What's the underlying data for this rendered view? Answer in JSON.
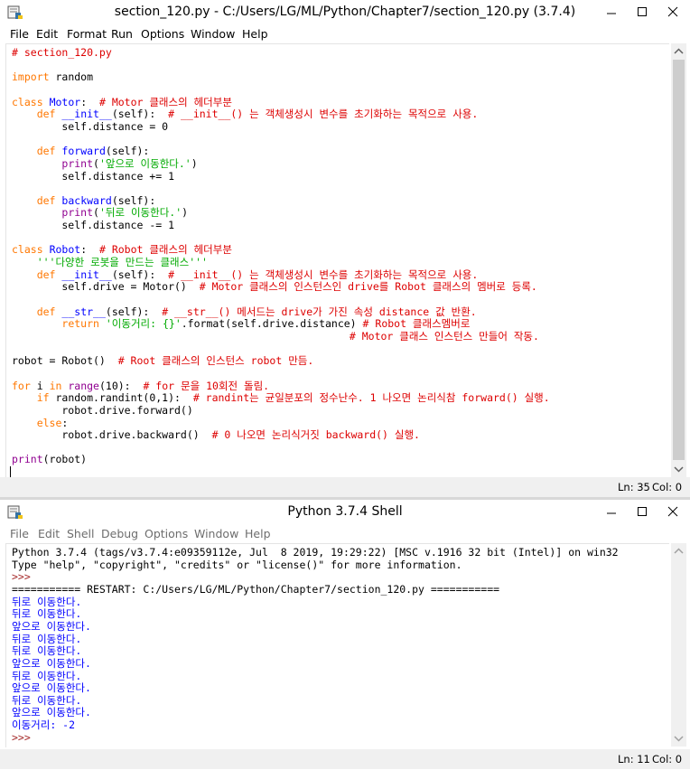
{
  "editor": {
    "title": "section_120.py - C:/Users/LG/ML/Python/Chapter7/section_120.py (3.7.4)",
    "menu": [
      "File",
      "Edit",
      "Format",
      "Run",
      "Options",
      "Window",
      "Help"
    ],
    "status_ln": "Ln: 35",
    "status_col": "Col: 0",
    "code_lines": [
      [
        [
          "comment",
          "# section_120.py"
        ]
      ],
      [],
      [
        [
          "kw",
          "import"
        ],
        [
          "plain",
          " random"
        ]
      ],
      [],
      [
        [
          "kw",
          "class"
        ],
        [
          "plain",
          " "
        ],
        [
          "def",
          "Motor"
        ],
        [
          "plain",
          ":  "
        ],
        [
          "comment",
          "# Motor 클래스의 헤더부분"
        ]
      ],
      [
        [
          "plain",
          "    "
        ],
        [
          "kw",
          "def"
        ],
        [
          "plain",
          " "
        ],
        [
          "def",
          "__init__"
        ],
        [
          "plain",
          "(self):  "
        ],
        [
          "comment",
          "# __init__() 는 객체생성시 변수를 초기화하는 목적으로 사용."
        ]
      ],
      [
        [
          "plain",
          "        self.distance = 0"
        ]
      ],
      [],
      [
        [
          "plain",
          "    "
        ],
        [
          "kw",
          "def"
        ],
        [
          "plain",
          " "
        ],
        [
          "def",
          "forward"
        ],
        [
          "plain",
          "(self):"
        ]
      ],
      [
        [
          "plain",
          "        "
        ],
        [
          "builtin",
          "print"
        ],
        [
          "plain",
          "("
        ],
        [
          "str",
          "'앞으로 이동한다.'"
        ],
        [
          "plain",
          ")"
        ]
      ],
      [
        [
          "plain",
          "        self.distance += 1"
        ]
      ],
      [],
      [
        [
          "plain",
          "    "
        ],
        [
          "kw",
          "def"
        ],
        [
          "plain",
          " "
        ],
        [
          "def",
          "backward"
        ],
        [
          "plain",
          "(self):"
        ]
      ],
      [
        [
          "plain",
          "        "
        ],
        [
          "builtin",
          "print"
        ],
        [
          "plain",
          "("
        ],
        [
          "str",
          "'뒤로 이동한다.'"
        ],
        [
          "plain",
          ")"
        ]
      ],
      [
        [
          "plain",
          "        self.distance -= 1"
        ]
      ],
      [],
      [
        [
          "kw",
          "class"
        ],
        [
          "plain",
          " "
        ],
        [
          "def",
          "Robot"
        ],
        [
          "plain",
          ":  "
        ],
        [
          "comment",
          "# Robot 클래스의 헤더부분"
        ]
      ],
      [
        [
          "plain",
          "    "
        ],
        [
          "str",
          "'''다양한 로봇을 만드는 클래스'''"
        ]
      ],
      [
        [
          "plain",
          "    "
        ],
        [
          "kw",
          "def"
        ],
        [
          "plain",
          " "
        ],
        [
          "def",
          "__init__"
        ],
        [
          "plain",
          "(self):  "
        ],
        [
          "comment",
          "# __init__() 는 객체생성시 변수를 초기화하는 목적으로 사용."
        ]
      ],
      [
        [
          "plain",
          "        self.drive = Motor()  "
        ],
        [
          "comment",
          "# Motor 클래스의 인스턴스인 drive를 Robot 클래스의 멤버로 등록."
        ]
      ],
      [],
      [
        [
          "plain",
          "    "
        ],
        [
          "kw",
          "def"
        ],
        [
          "plain",
          " "
        ],
        [
          "def",
          "__str__"
        ],
        [
          "plain",
          "(self):  "
        ],
        [
          "comment",
          "# __str__() 메서드는 drive가 가진 속성 distance 값 반환."
        ]
      ],
      [
        [
          "plain",
          "        "
        ],
        [
          "kw",
          "return"
        ],
        [
          "plain",
          " "
        ],
        [
          "str",
          "'이동거리: {}'"
        ],
        [
          "plain",
          ".format(self.drive.distance) "
        ],
        [
          "comment",
          "# Robot 클래스멤버로"
        ]
      ],
      [
        [
          "plain",
          "                                                      "
        ],
        [
          "comment",
          "# Motor 클래스 인스턴스 만들어 작동."
        ]
      ],
      [],
      [
        [
          "plain",
          "robot = Robot()  "
        ],
        [
          "comment",
          "# Root 클래스의 인스턴스 robot 만듬."
        ]
      ],
      [],
      [
        [
          "kw",
          "for"
        ],
        [
          "plain",
          " i "
        ],
        [
          "kw",
          "in"
        ],
        [
          "plain",
          " "
        ],
        [
          "builtin",
          "range"
        ],
        [
          "plain",
          "(10):  "
        ],
        [
          "comment",
          "# for 문을 10회전 돌림."
        ]
      ],
      [
        [
          "plain",
          "    "
        ],
        [
          "kw",
          "if"
        ],
        [
          "plain",
          " random.randint(0,1):  "
        ],
        [
          "comment",
          "# randint는 균일분포의 정수난수. 1 나오면 논리식참 forward() 실행."
        ]
      ],
      [
        [
          "plain",
          "        robot.drive.forward()"
        ]
      ],
      [
        [
          "plain",
          "    "
        ],
        [
          "kw",
          "else"
        ],
        [
          "plain",
          ":"
        ]
      ],
      [
        [
          "plain",
          "        robot.drive.backward()  "
        ],
        [
          "comment",
          "# 0 나오면 논리식거짓 backward() 실행."
        ]
      ],
      [],
      [
        [
          "builtin",
          "print"
        ],
        [
          "plain",
          "(robot)"
        ]
      ],
      []
    ]
  },
  "shell": {
    "title": "Python 3.7.4 Shell",
    "menu": [
      "File",
      "Edit",
      "Shell",
      "Debug",
      "Options",
      "Window",
      "Help"
    ],
    "status_ln": "Ln: 11",
    "status_col": "Col: 0",
    "lines": [
      [
        [
          "plain",
          "Python 3.7.4 (tags/v3.7.4:e09359112e, Jul  8 2019, 19:29:22) [MSC v.1916 32 bit (Intel)] on win32"
        ]
      ],
      [
        [
          "plain",
          "Type \"help\", \"copyright\", \"credits\" or \"license()\" for more information."
        ]
      ],
      [
        [
          "prompt",
          ">>> "
        ]
      ],
      [
        [
          "plain",
          "=========== RESTART: C:/Users/LG/ML/Python/Chapter7/section_120.py ==========="
        ]
      ],
      [
        [
          "out",
          "뒤로 이동한다."
        ]
      ],
      [
        [
          "out",
          "뒤로 이동한다."
        ]
      ],
      [
        [
          "out",
          "앞으로 이동한다."
        ]
      ],
      [
        [
          "out",
          "뒤로 이동한다."
        ]
      ],
      [
        [
          "out",
          "뒤로 이동한다."
        ]
      ],
      [
        [
          "out",
          "앞으로 이동한다."
        ]
      ],
      [
        [
          "out",
          "뒤로 이동한다."
        ]
      ],
      [
        [
          "out",
          "앞으로 이동한다."
        ]
      ],
      [
        [
          "out",
          "뒤로 이동한다."
        ]
      ],
      [
        [
          "out",
          "앞으로 이동한다."
        ]
      ],
      [
        [
          "out",
          "이동거리: -2"
        ]
      ],
      [
        [
          "prompt",
          ">>> "
        ]
      ]
    ]
  }
}
